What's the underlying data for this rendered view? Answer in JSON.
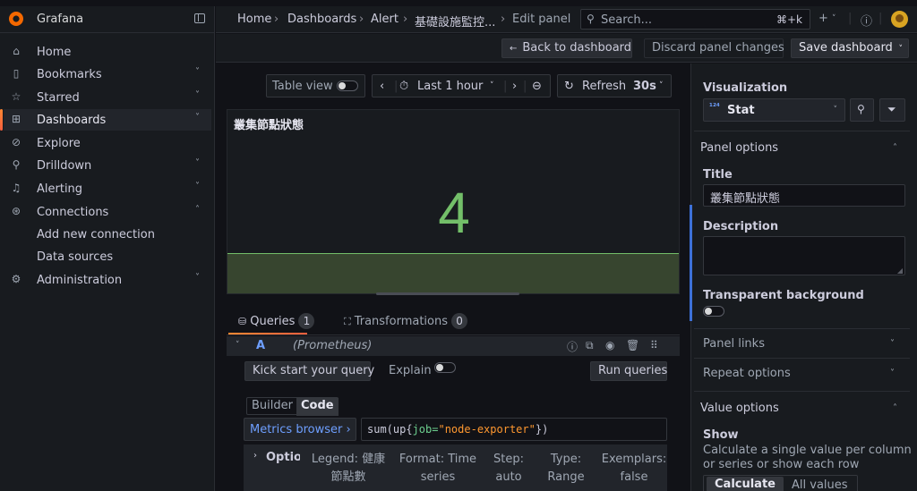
{
  "sidebar": {
    "brand": "Grafana",
    "items": [
      {
        "label": "Home",
        "icon": "home-icon",
        "chevron": ""
      },
      {
        "label": "Bookmarks",
        "icon": "bookmark-icon",
        "chevron": "˅"
      },
      {
        "label": "Starred",
        "icon": "star-icon",
        "chevron": "˅"
      },
      {
        "label": "Dashboards",
        "icon": "dashboards-icon",
        "chevron": "˅"
      },
      {
        "label": "Explore",
        "icon": "compass-icon",
        "chevron": ""
      },
      {
        "label": "Drilldown",
        "icon": "drilldown-icon",
        "chevron": "˅"
      },
      {
        "label": "Alerting",
        "icon": "bell-icon",
        "chevron": "˅"
      },
      {
        "label": "Connections",
        "icon": "connections-icon",
        "chevron": "˄"
      },
      {
        "label": "Administration",
        "icon": "cog-icon",
        "chevron": "˅"
      }
    ],
    "subitems": [
      "Add new connection",
      "Data sources"
    ]
  },
  "topbar": {
    "breadcrumbs": [
      "Home",
      "Dashboards",
      "Alert",
      "基礎設施監控...",
      "Edit panel"
    ],
    "search_placeholder": "Search...",
    "search_shortcut": "⌘+k"
  },
  "actionbar": {
    "back": "Back to dashboard",
    "discard": "Discard panel changes",
    "save": "Save dashboard"
  },
  "toolbar": {
    "table_view": "Table view",
    "time_range": "Last 1 hour",
    "refresh": "Refresh",
    "refresh_interval": "30s"
  },
  "panel": {
    "title": "叢集節點狀態",
    "value": "4",
    "value_color": "#73bf69"
  },
  "query_tabs": [
    {
      "label": "Queries",
      "count": "1"
    },
    {
      "label": "Transformations",
      "count": "0"
    }
  ],
  "query": {
    "ref": "A",
    "datasource": "(Prometheus)",
    "kick_start": "Kick start your query",
    "explain": "Explain",
    "run": "Run queries",
    "mode_builder": "Builder",
    "mode_code": "Code",
    "metrics_browser": "Metrics browser ›",
    "expr_prefix": "sum(up{",
    "expr_key": "job=",
    "expr_value": "\"node-exporter\"",
    "expr_suffix": "})",
    "options_label": "Optio",
    "options": [
      {
        "line1": "Legend: 健康",
        "line2": "節點數"
      },
      {
        "line1": "Format: Time",
        "line2": "series"
      },
      {
        "line1": "Step:",
        "line2": "auto"
      },
      {
        "line1": "Type:",
        "line2": "Range"
      },
      {
        "line1": "Exemplars:",
        "line2": "false"
      }
    ]
  },
  "options_pane": {
    "visualization_label": "Visualization",
    "visualization": "Stat",
    "panel_options": "Panel options",
    "title_label": "Title",
    "title_value": "叢集節點狀態",
    "description_label": "Description",
    "transparent_label": "Transparent background",
    "panel_links": "Panel links",
    "repeat_options": "Repeat options",
    "value_options": "Value options",
    "show_label": "Show",
    "show_desc_1": "Calculate a single value per column",
    "show_desc_2": "or series or show each row",
    "calculate": "Calculate",
    "all_values": "All values"
  },
  "colors": {
    "accent": "#f55f3e",
    "link": "#6e9fff",
    "stat_green": "#73bf69"
  }
}
